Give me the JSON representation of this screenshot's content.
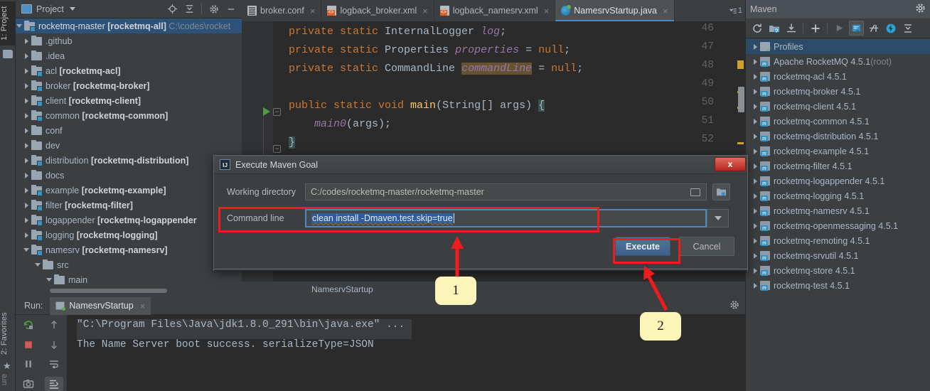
{
  "left_strip": {
    "project_tab": "1: Project",
    "favorites_tab": "2: Favorites",
    "structure_tab": "ure"
  },
  "project_panel": {
    "title": "Project",
    "icons": [
      "locate-icon",
      "collapse-all-icon",
      "gear-icon",
      "minimize-icon"
    ],
    "tree": [
      {
        "indent": 0,
        "arrow": "down",
        "icon": "folder-module",
        "label": "rocketmq-master",
        "bracket": "[rocketmq-all]",
        "path": "C:\\codes\\rocket",
        "selected": true
      },
      {
        "indent": 1,
        "arrow": "right",
        "icon": "folder",
        "label": ".github",
        "bracket": "",
        "path": ""
      },
      {
        "indent": 1,
        "arrow": "right",
        "icon": "folder",
        "label": ".idea",
        "bracket": "",
        "path": ""
      },
      {
        "indent": 1,
        "arrow": "right",
        "icon": "folder-module",
        "label": "acl",
        "bracket": "[rocketmq-acl]",
        "path": ""
      },
      {
        "indent": 1,
        "arrow": "right",
        "icon": "folder-module",
        "label": "broker",
        "bracket": "[rocketmq-broker]",
        "path": ""
      },
      {
        "indent": 1,
        "arrow": "right",
        "icon": "folder-module",
        "label": "client",
        "bracket": "[rocketmq-client]",
        "path": ""
      },
      {
        "indent": 1,
        "arrow": "right",
        "icon": "folder-module",
        "label": "common",
        "bracket": "[rocketmq-common]",
        "path": ""
      },
      {
        "indent": 1,
        "arrow": "right",
        "icon": "folder",
        "label": "conf",
        "bracket": "",
        "path": ""
      },
      {
        "indent": 1,
        "arrow": "right",
        "icon": "folder",
        "label": "dev",
        "bracket": "",
        "path": ""
      },
      {
        "indent": 1,
        "arrow": "right",
        "icon": "folder-module",
        "label": "distribution",
        "bracket": "[rocketmq-distribution]",
        "path": ""
      },
      {
        "indent": 1,
        "arrow": "right",
        "icon": "folder",
        "label": "docs",
        "bracket": "",
        "path": ""
      },
      {
        "indent": 1,
        "arrow": "right",
        "icon": "folder-module",
        "label": "example",
        "bracket": "[rocketmq-example]",
        "path": ""
      },
      {
        "indent": 1,
        "arrow": "right",
        "icon": "folder-module",
        "label": "filter",
        "bracket": "[rocketmq-filter]",
        "path": ""
      },
      {
        "indent": 1,
        "arrow": "right",
        "icon": "folder-module",
        "label": "logappender",
        "bracket": "[rocketmq-logappender",
        "path": ""
      },
      {
        "indent": 1,
        "arrow": "right",
        "icon": "folder-module",
        "label": "logging",
        "bracket": "[rocketmq-logging]",
        "path": ""
      },
      {
        "indent": 1,
        "arrow": "down",
        "icon": "folder-module",
        "label": "namesrv",
        "bracket": "[rocketmq-namesrv]",
        "path": ""
      },
      {
        "indent": 2,
        "arrow": "down",
        "icon": "folder",
        "label": "src",
        "bracket": "",
        "path": ""
      },
      {
        "indent": 3,
        "arrow": "down",
        "icon": "folder",
        "label": "main",
        "bracket": "",
        "path": ""
      }
    ]
  },
  "editor": {
    "tabs": [
      {
        "label": "broker.conf",
        "icon": "conf-file-icon",
        "active": false
      },
      {
        "label": "logback_broker.xml",
        "icon": "xml-file-icon",
        "active": false
      },
      {
        "label": "logback_namesrv.xml",
        "icon": "xml-file-icon",
        "active": false
      },
      {
        "label": "NamesrvStartup.java",
        "icon": "java-class-icon",
        "active": true
      }
    ],
    "tabs_right_label": "1",
    "line_numbers": [
      "46",
      "47",
      "48",
      "49",
      "50",
      "51",
      "52"
    ],
    "code_lines": [
      {
        "num": "46",
        "segments": [
          {
            "t": "private ",
            "c": "kw"
          },
          {
            "t": "static ",
            "c": "kw"
          },
          {
            "t": "InternalLogger ",
            "c": "cls"
          },
          {
            "t": "log",
            "c": "fld-it"
          },
          {
            "t": ";",
            "c": "punc"
          }
        ]
      },
      {
        "num": "47",
        "segments": [
          {
            "t": "private ",
            "c": "kw"
          },
          {
            "t": "static ",
            "c": "kw"
          },
          {
            "t": "Properties ",
            "c": "cls"
          },
          {
            "t": "properties",
            "c": "fld-it"
          },
          {
            "t": " = ",
            "c": "punc"
          },
          {
            "t": "null",
            "c": "kw"
          },
          {
            "t": ";",
            "c": "punc"
          }
        ]
      },
      {
        "num": "48",
        "segments": [
          {
            "t": "private ",
            "c": "kw"
          },
          {
            "t": "static ",
            "c": "kw"
          },
          {
            "t": "CommandLine ",
            "c": "cls"
          },
          {
            "t": "commandLine",
            "c": "fld-hl"
          },
          {
            "t": " = ",
            "c": "punc"
          },
          {
            "t": "null",
            "c": "kw"
          },
          {
            "t": ";",
            "c": "punc"
          }
        ]
      },
      {
        "num": "49",
        "segments": []
      },
      {
        "num": "50",
        "segments": [
          {
            "t": "public ",
            "c": "kw"
          },
          {
            "t": "static ",
            "c": "kw"
          },
          {
            "t": "void ",
            "c": "kw"
          },
          {
            "t": "main",
            "c": "mth"
          },
          {
            "t": "(String[] args) ",
            "c": "punc"
          },
          {
            "t": "{",
            "c": "brace-hl"
          }
        ]
      },
      {
        "num": "51",
        "segments": [
          {
            "t": "    ",
            "c": "punc"
          },
          {
            "t": "main0",
            "c": "fld-it"
          },
          {
            "t": "(args)",
            "c": "punc"
          },
          {
            "t": ";",
            "c": "punc"
          }
        ]
      },
      {
        "num": "52",
        "segments": [
          {
            "t": "}",
            "c": "brace-hl"
          }
        ]
      }
    ],
    "status_text": "NamesrvStartup"
  },
  "maven": {
    "title": "Maven",
    "toolbar_icons": [
      "refresh-icon",
      "add-maven-project-icon",
      "download-sources-icon",
      "plus-icon",
      "run-icon",
      "toggle-offline-icon",
      "skip-tests-icon",
      "execute-goal-icon",
      "collapse-all-icon"
    ],
    "tree": [
      {
        "label": "Profiles",
        "note": "",
        "icon": "profiles-icon",
        "selected": true
      },
      {
        "label": "Apache RocketMQ 4.5.1",
        "note": "(root)",
        "icon": "maven-project-icon",
        "selected": false
      },
      {
        "label": "rocketmq-acl 4.5.1",
        "note": "",
        "icon": "maven-project-icon",
        "selected": false
      },
      {
        "label": "rocketmq-broker 4.5.1",
        "note": "",
        "icon": "maven-project-icon",
        "selected": false
      },
      {
        "label": "rocketmq-client 4.5.1",
        "note": "",
        "icon": "maven-project-icon",
        "selected": false
      },
      {
        "label": "rocketmq-common 4.5.1",
        "note": "",
        "icon": "maven-project-icon",
        "selected": false
      },
      {
        "label": "rocketmq-distribution 4.5.1",
        "note": "",
        "icon": "maven-project-icon",
        "selected": false
      },
      {
        "label": "rocketmq-example 4.5.1",
        "note": "",
        "icon": "maven-project-icon",
        "selected": false
      },
      {
        "label": "rocketmq-filter 4.5.1",
        "note": "",
        "icon": "maven-project-icon",
        "selected": false
      },
      {
        "label": "rocketmq-logappender 4.5.1",
        "note": "",
        "icon": "maven-project-icon",
        "selected": false
      },
      {
        "label": "rocketmq-logging 4.5.1",
        "note": "",
        "icon": "maven-project-icon",
        "selected": false
      },
      {
        "label": "rocketmq-namesrv 4.5.1",
        "note": "",
        "icon": "maven-project-icon",
        "selected": false
      },
      {
        "label": "rocketmq-openmessaging 4.5.1",
        "note": "",
        "icon": "maven-project-icon",
        "selected": false
      },
      {
        "label": "rocketmq-remoting 4.5.1",
        "note": "",
        "icon": "maven-project-icon",
        "selected": false
      },
      {
        "label": "rocketmq-srvutil 4.5.1",
        "note": "",
        "icon": "maven-project-icon",
        "selected": false
      },
      {
        "label": "rocketmq-store 4.5.1",
        "note": "",
        "icon": "maven-project-icon",
        "selected": false
      },
      {
        "label": "rocketmq-test 4.5.1",
        "note": "",
        "icon": "maven-project-icon",
        "selected": false
      }
    ]
  },
  "run_panel": {
    "run_label": "Run:",
    "tab_label": "NamesrvStartup",
    "console_lines": [
      "\"C:\\Program Files\\Java\\jdk1.8.0_291\\bin\\java.exe\" ...",
      "The Name Server boot success. serializeType=JSON"
    ],
    "side_icons": [
      "rerun-icon",
      "stop-icon",
      "pause-icon",
      "camera-icon",
      "up-icon",
      "down-icon",
      "soft-wrap-icon",
      "scroll-to-end-icon"
    ]
  },
  "dialog": {
    "title": "Execute Maven Goal",
    "close_label": "x",
    "working_directory_label": "Working directory",
    "working_directory_value": "C:/codes/rocketmq-master/rocketmq-master",
    "command_line_label": "Command line",
    "command_line_value": "clean install -Dmaven.test.skip=true",
    "execute_button": "Execute",
    "cancel_button": "Cancel"
  },
  "annotations": {
    "callout_1": "1",
    "callout_2": "2",
    "highlight_color": "#ee1c1c",
    "callout_bg": "#fbf5ba"
  }
}
